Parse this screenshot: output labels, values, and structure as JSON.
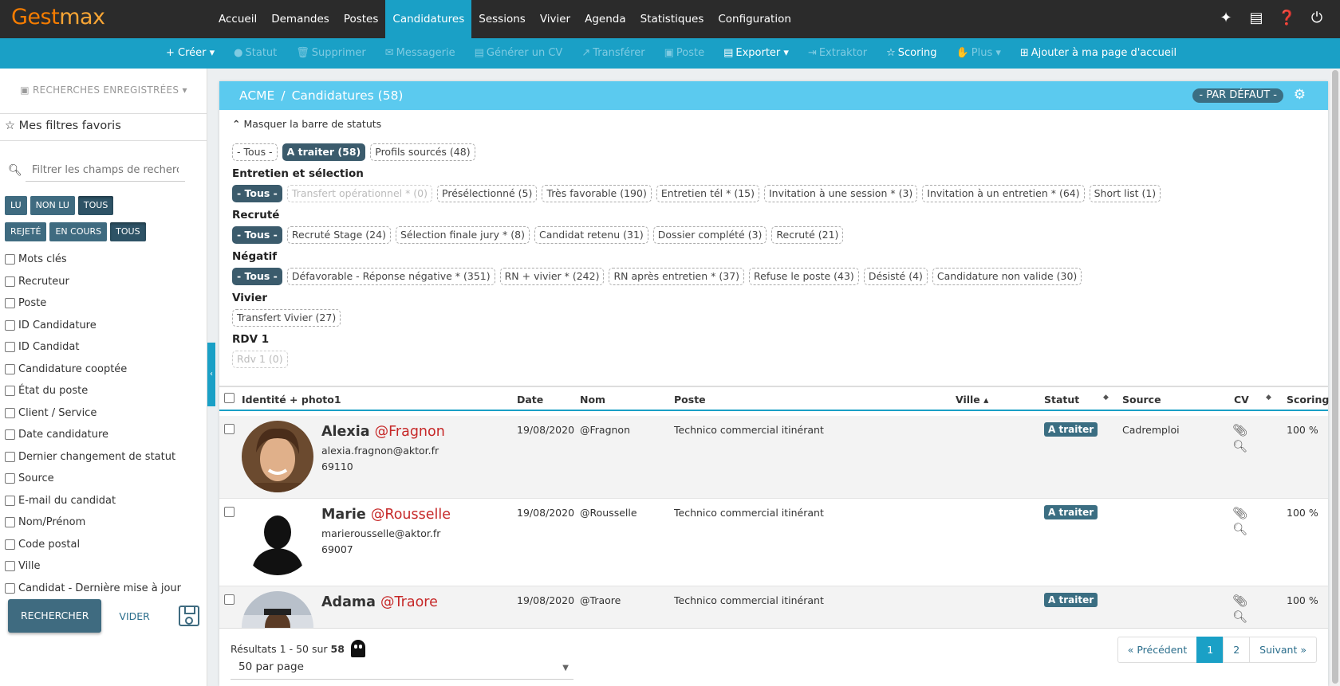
{
  "app": {
    "logo_part1": "Gest",
    "logo_part2": "max"
  },
  "nav": {
    "items": [
      {
        "label": "Accueil",
        "active": false
      },
      {
        "label": "Demandes",
        "active": false
      },
      {
        "label": "Postes",
        "active": false
      },
      {
        "label": "Candidatures",
        "active": true
      },
      {
        "label": "Sessions",
        "active": false
      },
      {
        "label": "Vivier",
        "active": false
      },
      {
        "label": "Agenda",
        "active": false
      },
      {
        "label": "Statistiques",
        "active": false
      },
      {
        "label": "Configuration",
        "active": false
      }
    ],
    "icons": [
      "magic-wand-icon",
      "list-icon",
      "help-icon",
      "power-icon"
    ]
  },
  "actionbar": {
    "items": [
      {
        "label": "+ Créer ▾",
        "disabled": false,
        "icon": ""
      },
      {
        "label": "Statut",
        "disabled": true,
        "icon": "●"
      },
      {
        "label": "Supprimer",
        "disabled": true,
        "icon": "🗑"
      },
      {
        "label": "Messagerie",
        "disabled": true,
        "icon": "✉"
      },
      {
        "label": "Générer un CV",
        "disabled": true,
        "icon": "▤"
      },
      {
        "label": "Transférer",
        "disabled": true,
        "icon": "↗"
      },
      {
        "label": "Poste",
        "disabled": true,
        "icon": "▣"
      },
      {
        "label": "Exporter ▾",
        "disabled": false,
        "icon": "▤"
      },
      {
        "label": "Extraktor",
        "disabled": true,
        "icon": "⇥"
      },
      {
        "label": "Scoring",
        "disabled": false,
        "icon": "☆"
      },
      {
        "label": "Plus ▾",
        "disabled": true,
        "icon": "✋"
      },
      {
        "label": "Ajouter à ma page d'accueil",
        "disabled": false,
        "icon": "⊞"
      }
    ]
  },
  "sidebar": {
    "saved_searches": "RECHERCHES ENREGISTRÉES",
    "favorites": "Mes filtres favoris",
    "filter_placeholder": "Filtrer les champs de recherche",
    "read_group": [
      {
        "label": "LU",
        "active": false
      },
      {
        "label": "NON LU",
        "active": false
      },
      {
        "label": "TOUS",
        "active": true
      }
    ],
    "state_group": [
      {
        "label": "REJETÉ",
        "active": false
      },
      {
        "label": "EN COURS",
        "active": false
      },
      {
        "label": "TOUS",
        "active": true
      }
    ],
    "criteria": [
      "Mots clés",
      "Recruteur",
      "Poste",
      "ID Candidature",
      "ID Candidat",
      "Candidature cooptée",
      "État du poste",
      "Client / Service",
      "Date candidature",
      "Dernier changement de statut",
      "Source",
      "E-mail du candidat",
      "Nom/Prénom",
      "Code postal",
      "Ville",
      "Candidat - Dernière mise à jour"
    ],
    "search_button": "RECHERCHER",
    "clear_button": "VIDER"
  },
  "panel": {
    "breadcrumb_root": "ACME",
    "breadcrumb_current": "Candidatures (58)",
    "view_label": "- PAR DÉFAUT -",
    "toggle_status_bar": "Masquer la barre de statuts",
    "top_chips": [
      {
        "label": "- Tous -",
        "state": "normal"
      },
      {
        "label": "A traiter (58)",
        "state": "on"
      },
      {
        "label": "Profils sourcés (48)",
        "state": "normal"
      }
    ],
    "groups": [
      {
        "title": "Entretien et sélection",
        "chips": [
          {
            "label": "- Tous -",
            "state": "on"
          },
          {
            "label": "Transfert opérationnel * (0)",
            "state": "dis"
          },
          {
            "label": "Présélectionné (5)",
            "state": "normal"
          },
          {
            "label": "Très favorable (190)",
            "state": "normal"
          },
          {
            "label": "Entretien tél * (15)",
            "state": "normal"
          },
          {
            "label": "Invitation à une session * (3)",
            "state": "normal"
          },
          {
            "label": "Invitation à un entretien * (64)",
            "state": "normal"
          },
          {
            "label": "Short list (1)",
            "state": "normal"
          }
        ]
      },
      {
        "title": "Recruté",
        "chips": [
          {
            "label": "- Tous -",
            "state": "on"
          },
          {
            "label": "Recruté Stage (24)",
            "state": "normal"
          },
          {
            "label": "Sélection finale jury * (8)",
            "state": "normal"
          },
          {
            "label": "Candidat retenu (31)",
            "state": "normal"
          },
          {
            "label": "Dossier complété (3)",
            "state": "normal"
          },
          {
            "label": "Recruté (21)",
            "state": "normal"
          }
        ]
      },
      {
        "title": "Négatif",
        "chips": [
          {
            "label": "- Tous -",
            "state": "on"
          },
          {
            "label": "Défavorable - Réponse négative * (351)",
            "state": "normal"
          },
          {
            "label": "RN + vivier * (242)",
            "state": "normal"
          },
          {
            "label": "RN après entretien * (37)",
            "state": "normal"
          },
          {
            "label": "Refuse le poste (43)",
            "state": "normal"
          },
          {
            "label": "Désisté (4)",
            "state": "normal"
          },
          {
            "label": "Candidature non valide (30)",
            "state": "normal"
          }
        ]
      },
      {
        "title": "Vivier",
        "chips": [
          {
            "label": "Transfert Vivier (27)",
            "state": "normal"
          }
        ]
      },
      {
        "title": "RDV 1",
        "chips": [
          {
            "label": "Rdv 1  (0)",
            "state": "dis"
          }
        ]
      }
    ]
  },
  "table": {
    "columns": {
      "identity": "Identité + photo1",
      "date": "Date",
      "nom": "Nom",
      "poste": "Poste",
      "ville": "Ville ▴",
      "statut": "Statut",
      "source": "Source",
      "cv": "CV",
      "scoring": "Scoring"
    },
    "rows": [
      {
        "first": "Alexia",
        "last": "@Fragnon",
        "email": "alexia.fragnon@aktor.fr",
        "zip": "69110",
        "date": "19/08/2020",
        "nom": "@Fragnon",
        "poste": "Technico commercial itinérant",
        "ville": "",
        "statut": "A traiter",
        "source": "Cadremploi",
        "scoring": "100 %",
        "photo": "woman"
      },
      {
        "first": "Marie",
        "last": "@Rousselle",
        "email": "marierousselle@aktor.fr",
        "zip": "69007",
        "date": "19/08/2020",
        "nom": "@Rousselle",
        "poste": "Technico commercial itinérant",
        "ville": "",
        "statut": "A traiter",
        "source": "",
        "scoring": "100 %",
        "photo": "silhouette"
      },
      {
        "first": "Adama",
        "last": "@Traore",
        "email": "",
        "zip": "",
        "date": "19/08/2020",
        "nom": "@Traore",
        "poste": "Technico commercial itinérant",
        "ville": "",
        "statut": "A traiter",
        "source": "",
        "scoring": "100 %",
        "photo": "man"
      }
    ]
  },
  "footer": {
    "results_prefix": "Résultats 1 - 50 sur",
    "results_total": "58",
    "per_page": "50 par page",
    "pagination": [
      {
        "label": "« Précédent",
        "active": false
      },
      {
        "label": "1",
        "active": true
      },
      {
        "label": "2",
        "active": false
      },
      {
        "label": "Suivant »",
        "active": false
      }
    ]
  }
}
